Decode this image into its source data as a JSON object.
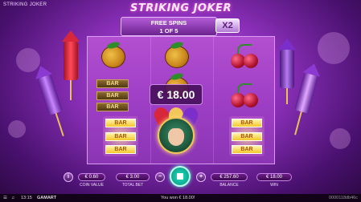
{
  "game": {
    "title_small": "STRIKING JOKER",
    "logo": "STRIKING JOKER"
  },
  "free_spins": {
    "label": "FREE SPINS",
    "progress": "1 OF 5",
    "multiplier": "X2"
  },
  "reels": {
    "win_amount": "€ 18.00",
    "bar_text": "BAR"
  },
  "controls": {
    "info_icon": "i",
    "coin_value": {
      "value": "€ 0.60",
      "label": "COIN VALUE"
    },
    "total_bet": {
      "value": "€ 3.00",
      "label": "TOTAL BET"
    },
    "balance": {
      "value": "€ 257.60",
      "label": "BALANCE"
    },
    "win": {
      "value": "€ 18.00",
      "label": "WIN"
    },
    "minus_icon": "−",
    "plus_icon": "+"
  },
  "status": {
    "time": "13:15",
    "brand": "GAMART",
    "message": "You won € 18.00!",
    "round_id": "0000118db46c"
  },
  "colors": {
    "accent": "#c35ee0",
    "spin": "#1fe3c0"
  }
}
